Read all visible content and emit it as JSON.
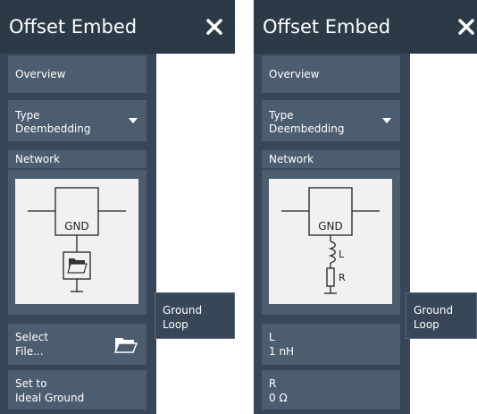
{
  "left_panel": {
    "title": "Offset Embed",
    "overview": "Overview",
    "type_label": "Type",
    "type_value": "Deembedding",
    "network_label": "Network",
    "gnd_label": "GND",
    "ground_loop_line1": "Ground",
    "ground_loop_line2": "Loop",
    "select_file_line1": "Select",
    "select_file_line2": "File...",
    "ideal_ground_line1": "Set to",
    "ideal_ground_line2": "Ideal Ground"
  },
  "right_panel": {
    "title": "Offset Embed",
    "overview": "Overview",
    "type_label": "Type",
    "type_value": "Deembedding",
    "network_label": "Network",
    "gnd_label": "GND",
    "inductor_label": "L",
    "resistor_label": "R",
    "ground_loop_line1": "Ground",
    "ground_loop_line2": "Loop",
    "L_label": "L",
    "L_value": "1 nH",
    "R_label": "R",
    "R_value": "0 Ω"
  },
  "icons": [
    "close-icon",
    "dropdown-arrow-icon",
    "folder-icon",
    "circuit-diagram"
  ],
  "colors": {
    "titlebar": "#2c3a48",
    "sidepanel": "#384757",
    "button": "#4c5d6f",
    "diagram_bg": "#f1f1f1"
  }
}
